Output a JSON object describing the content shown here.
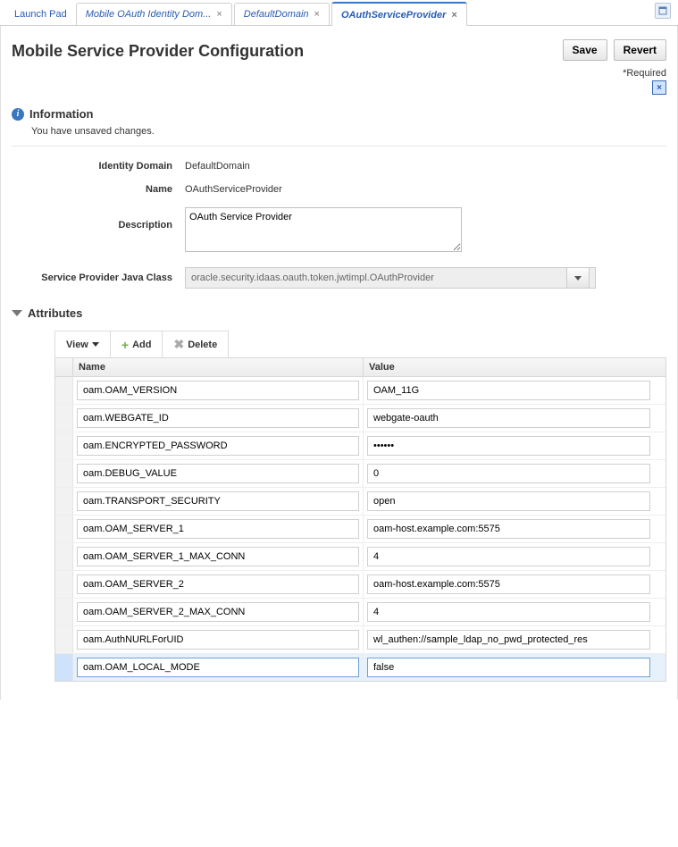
{
  "tabs": {
    "launch_pad": "Launch Pad",
    "items": [
      {
        "label": "Mobile OAuth Identity Dom..."
      },
      {
        "label": "DefaultDomain"
      },
      {
        "label": "OAuthServiceProvider"
      }
    ],
    "active_index": 2
  },
  "header": {
    "title": "Mobile Service Provider Configuration",
    "save": "Save",
    "revert": "Revert",
    "required": "*Required"
  },
  "info": {
    "title": "Information",
    "message": "You have unsaved changes."
  },
  "form": {
    "identity_domain": {
      "label": "Identity Domain",
      "value": "DefaultDomain"
    },
    "name": {
      "label": "Name",
      "value": "OAuthServiceProvider"
    },
    "description": {
      "label": "Description",
      "value": "OAuth Service Provider"
    },
    "java_class": {
      "label": "Service Provider Java Class",
      "value": "oracle.security.idaas.oauth.token.jwtimpl.OAuthProvider"
    }
  },
  "attributes": {
    "section_title": "Attributes",
    "toolbar": {
      "view": "View",
      "add": "Add",
      "delete": "Delete"
    },
    "columns": {
      "name": "Name",
      "value": "Value"
    },
    "rows": [
      {
        "name": "oam.OAM_VERSION",
        "value": "OAM_11G"
      },
      {
        "name": "oam.WEBGATE_ID",
        "value": "webgate-oauth"
      },
      {
        "name": "oam.ENCRYPTED_PASSWORD",
        "value": "••••••"
      },
      {
        "name": "oam.DEBUG_VALUE",
        "value": "0"
      },
      {
        "name": "oam.TRANSPORT_SECURITY",
        "value": "open"
      },
      {
        "name": "oam.OAM_SERVER_1",
        "value": "oam-host.example.com:5575"
      },
      {
        "name": "oam.OAM_SERVER_1_MAX_CONN",
        "value": "4"
      },
      {
        "name": "oam.OAM_SERVER_2",
        "value": "oam-host.example.com:5575"
      },
      {
        "name": "oam.OAM_SERVER_2_MAX_CONN",
        "value": "4"
      },
      {
        "name": "oam.AuthNURLForUID",
        "value": "wl_authen://sample_ldap_no_pwd_protected_res"
      },
      {
        "name": "oam.OAM_LOCAL_MODE",
        "value": "false"
      }
    ],
    "selected_row_index": 10
  }
}
